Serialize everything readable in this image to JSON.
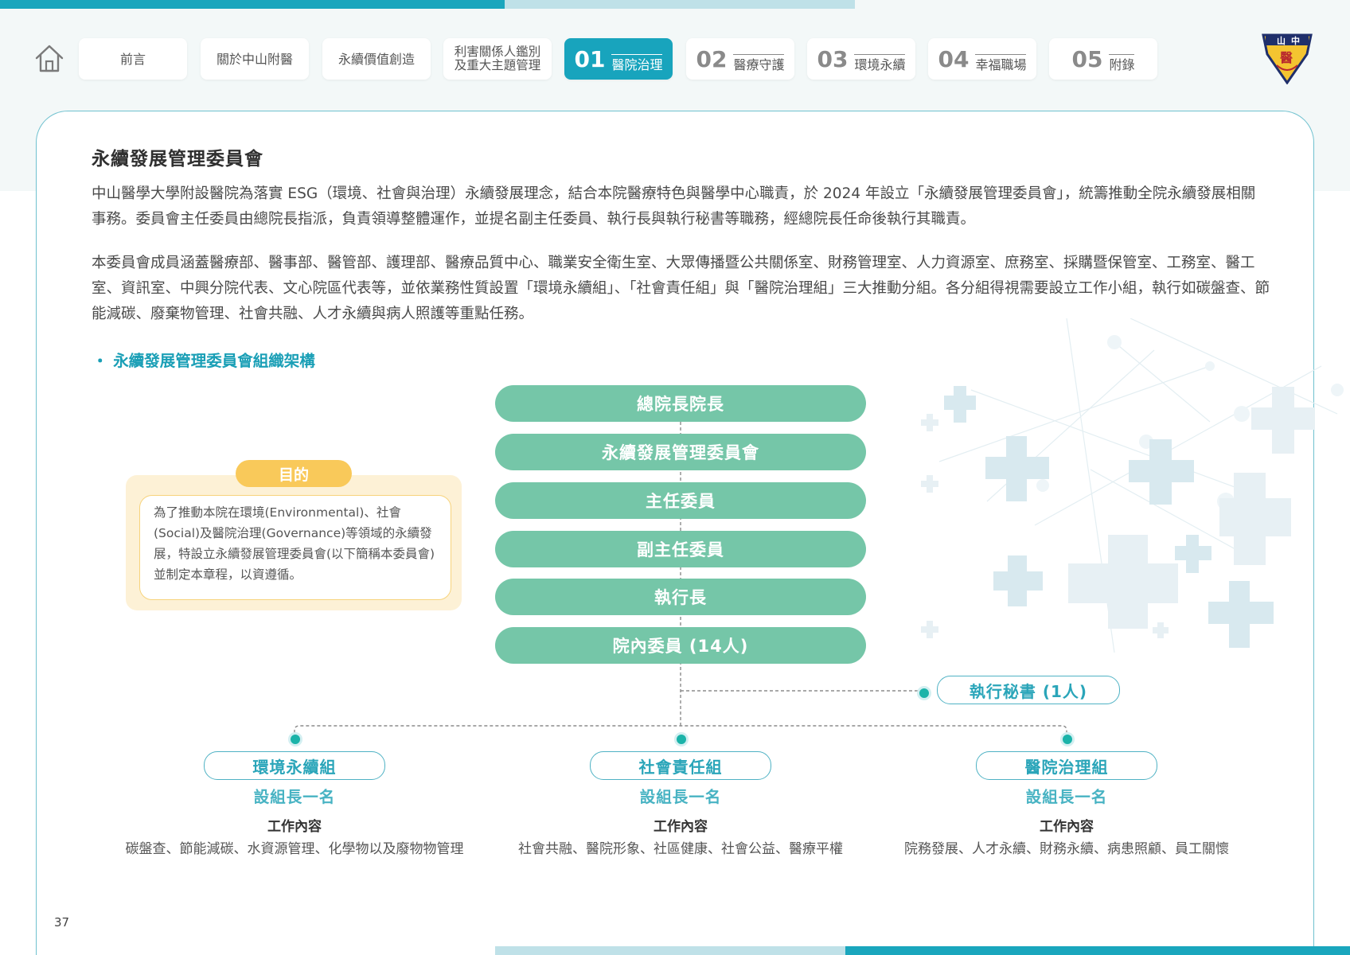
{
  "nav": {
    "tabs": [
      {
        "label": "前言"
      },
      {
        "label": "關於中山附醫"
      },
      {
        "label": "永續價值創造"
      },
      {
        "label_line1": "利害關係人鑑別",
        "label_line2": "及重大主題管理"
      },
      {
        "num": "01",
        "label": "醫院治理"
      },
      {
        "num": "02",
        "label": "醫療守護"
      },
      {
        "num": "03",
        "label": "環境永續"
      },
      {
        "num": "04",
        "label": "幸福職場"
      },
      {
        "num": "05",
        "label": "附錄"
      }
    ]
  },
  "logo": {
    "text_top": "山中",
    "text_mid": "醫"
  },
  "section": {
    "title": "永續發展管理委員會",
    "para1": "中山醫學大學附設醫院為落實 ESG（環境、社會與治理）永續發展理念，結合本院醫療特色與醫學中心職責，於 2024 年設立「永續發展管理委員會」，統籌推動全院永續發展相關事務。委員會主任委員由總院長指派，負責領導整體運作，並提名副主任委員、執行長與執行秘書等職務，經總院長任命後執行其職責。",
    "para2": "本委員會成員涵蓋醫療部、醫事部、醫管部、護理部、醫療品質中心、職業安全衛生室、大眾傳播暨公共關係室、財務管理室、人力資源室、庶務室、採購暨保管室、工務室、醫工室、資訊室、中興分院代表、文心院區代表等，並依業務性質設置「環境永續組」、「社會責任組」與「醫院治理組」三大推動分組。各分組得視需要設立工作小組，執行如碳盤查、節能減碳、廢棄物管理、社會共融、人才永續與病人照護等重點任務。",
    "subhead": "・ 永續發展管理委員會組織架構"
  },
  "org": {
    "levels": [
      "總院長院長",
      "永續發展管理委員會",
      "主任委員",
      "副主任委員",
      "執行長",
      "院內委員 (14人)"
    ],
    "secretary": "執行秘書 (1人)",
    "purpose": {
      "tag": "目的",
      "text": "為了推動本院在環境(Environmental)、社會(Social)及醫院治理(Governance)等領域的永續發展，特設立永續發展管理委員會(以下簡稱本委員會)並制定本章程，以資遵循。"
    },
    "groups": [
      {
        "name": "環境永續組",
        "leader": "設組長一名",
        "work_title": "工作內容",
        "work": "碳盤查、節能減碳、水資源管理、化學物以及廢物物管理"
      },
      {
        "name": "社會責任組",
        "leader": "設組長一名",
        "work_title": "工作內容",
        "work": "社會共融、醫院形象、社區健康、社會公益、醫療平權"
      },
      {
        "name": "醫院治理組",
        "leader": "設組長一名",
        "work_title": "工作內容",
        "work": "院務發展、人才永續、財務永續、病患照顧、員工關懷"
      }
    ]
  },
  "page_number": "37",
  "colors": {
    "accent": "#18a4bd",
    "pill": "#75c6a8",
    "purpose": "#f9c95a"
  }
}
